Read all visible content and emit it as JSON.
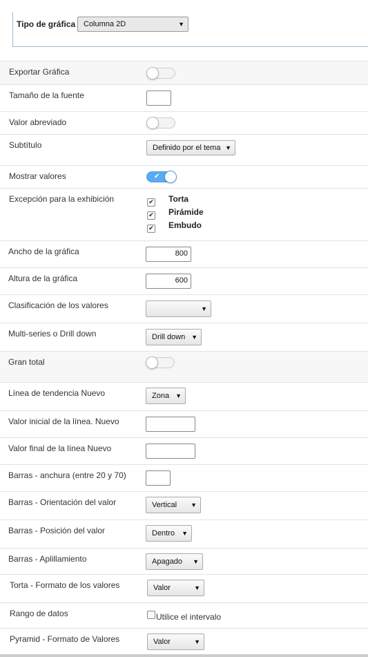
{
  "chart_type": {
    "label": "Tipo de gráfica",
    "value": "Columna 2D"
  },
  "rows": {
    "export": {
      "label": "Exportar Gráfica",
      "state": false
    },
    "font_size": {
      "label": "Tamaño de la fuente",
      "value": ""
    },
    "abbrev": {
      "label": "Valor abreviado",
      "state": false
    },
    "subtitle": {
      "label": "Subtítulo",
      "value": "Definido por el tema"
    },
    "show_values": {
      "label": "Mostrar valores",
      "state": true
    },
    "exception": {
      "label": "Excepción para la exhibición",
      "options": [
        {
          "label": "Torta",
          "checked": true
        },
        {
          "label": "Pirámide",
          "checked": true
        },
        {
          "label": "Embudo",
          "checked": true
        }
      ]
    },
    "width": {
      "label": "Ancho de la gráfica",
      "value": "800"
    },
    "height": {
      "label": "Altura de la gráfica",
      "value": "600"
    },
    "sort": {
      "label": "Clasificación de los valores",
      "value": ""
    },
    "multiseries": {
      "label": "Multi-series o Drill down",
      "value": "Drill down"
    },
    "grand_total": {
      "label": "Gran total",
      "state": false
    },
    "trendline": {
      "label": "Línea de tendencia Nuevo",
      "value": "Zona"
    },
    "line_start": {
      "label": "Valor inicial de la línea. Nuevo",
      "value": ""
    },
    "line_end": {
      "label": "Valor final de la línea Nuevo",
      "value": ""
    },
    "bar_width": {
      "label": "Barras - anchura (entre 20 y 70)",
      "value": ""
    },
    "bar_orientation": {
      "label": "Barras - Orientación del valor",
      "value": "Vertical"
    },
    "bar_position": {
      "label": "Barras - Posición del valor",
      "value": "Dentro"
    },
    "bar_stack": {
      "label": "Barras - Aplillamiento",
      "value": "Apagado"
    },
    "pie_format": {
      "label": "Torta - Formato de los valores",
      "value": "Valor"
    },
    "data_range": {
      "label": "Rango de datos",
      "checkbox_label": "Utilice el intervalo",
      "checked": false
    },
    "pyramid_format": {
      "label": "Pyramid - Formato de Valores",
      "value": "Valor"
    }
  },
  "colors": {
    "accent": "#5aabf0",
    "border": "#9fb7c9"
  }
}
